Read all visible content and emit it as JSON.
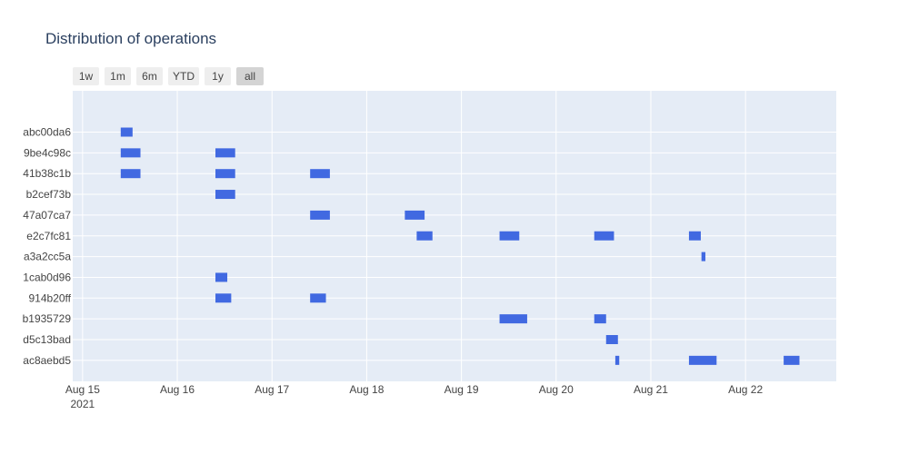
{
  "header": {
    "title": "Distribution of operations"
  },
  "range_selector": {
    "buttons": [
      {
        "label": "1w"
      },
      {
        "label": "1m"
      },
      {
        "label": "6m"
      },
      {
        "label": "YTD"
      },
      {
        "label": "1y"
      },
      {
        "label": "all",
        "active": true
      }
    ]
  },
  "colors": {
    "plot_bg": "#e5ecf6",
    "bar": "#4169e1",
    "grid": "#ffffff"
  },
  "chart_data": {
    "type": "timeline",
    "title": "Distribution of operations",
    "xlabel": "",
    "ylabel": "",
    "x_range": [
      "2021-08-14T21:30",
      "2021-08-22T23:00"
    ],
    "x_ticks": [
      {
        "value": "2021-08-15",
        "label": "Aug 15",
        "sublabel": "2021"
      },
      {
        "value": "2021-08-16",
        "label": "Aug 16"
      },
      {
        "value": "2021-08-17",
        "label": "Aug 17"
      },
      {
        "value": "2021-08-18",
        "label": "Aug 18"
      },
      {
        "value": "2021-08-19",
        "label": "Aug 19"
      },
      {
        "value": "2021-08-20",
        "label": "Aug 20"
      },
      {
        "value": "2021-08-21",
        "label": "Aug 21"
      },
      {
        "value": "2021-08-22",
        "label": "Aug 22"
      }
    ],
    "categories": [
      "abc00da6",
      "9be4c98c",
      "41b38c1b",
      "b2cef73b",
      "47a07ca7",
      "e2c7fc81",
      "a3a2cc5a",
      "1cab0d96",
      "914b20ff",
      "b1935729",
      "d5c13bad",
      "ac8aebd5"
    ],
    "series": [
      {
        "color": "#4169e1",
        "tasks": [
          {
            "row": "abc00da6",
            "start": "2021-08-15T09:40",
            "end": "2021-08-15T12:40"
          },
          {
            "row": "9be4c98c",
            "start": "2021-08-15T09:40",
            "end": "2021-08-15T14:40"
          },
          {
            "row": "9be4c98c",
            "start": "2021-08-16T09:40",
            "end": "2021-08-16T14:40"
          },
          {
            "row": "41b38c1b",
            "start": "2021-08-15T09:40",
            "end": "2021-08-15T14:40"
          },
          {
            "row": "41b38c1b",
            "start": "2021-08-16T09:40",
            "end": "2021-08-16T14:40"
          },
          {
            "row": "41b38c1b",
            "start": "2021-08-17T09:40",
            "end": "2021-08-17T14:40"
          },
          {
            "row": "b2cef73b",
            "start": "2021-08-16T09:40",
            "end": "2021-08-16T14:40"
          },
          {
            "row": "47a07ca7",
            "start": "2021-08-17T09:40",
            "end": "2021-08-17T14:40"
          },
          {
            "row": "47a07ca7",
            "start": "2021-08-18T09:40",
            "end": "2021-08-18T14:40"
          },
          {
            "row": "e2c7fc81",
            "start": "2021-08-18T12:40",
            "end": "2021-08-18T16:40"
          },
          {
            "row": "e2c7fc81",
            "start": "2021-08-19T09:40",
            "end": "2021-08-19T14:40"
          },
          {
            "row": "e2c7fc81",
            "start": "2021-08-20T09:40",
            "end": "2021-08-20T14:40"
          },
          {
            "row": "e2c7fc81",
            "start": "2021-08-21T09:40",
            "end": "2021-08-21T12:40"
          },
          {
            "row": "a3a2cc5a",
            "start": "2021-08-21T12:50",
            "end": "2021-08-21T13:50"
          },
          {
            "row": "1cab0d96",
            "start": "2021-08-16T09:40",
            "end": "2021-08-16T12:40"
          },
          {
            "row": "914b20ff",
            "start": "2021-08-16T09:40",
            "end": "2021-08-16T13:40"
          },
          {
            "row": "914b20ff",
            "start": "2021-08-17T09:40",
            "end": "2021-08-17T13:40"
          },
          {
            "row": "b1935729",
            "start": "2021-08-19T09:40",
            "end": "2021-08-19T16:40"
          },
          {
            "row": "b1935729",
            "start": "2021-08-20T09:40",
            "end": "2021-08-20T12:40"
          },
          {
            "row": "d5c13bad",
            "start": "2021-08-20T12:40",
            "end": "2021-08-20T15:40"
          },
          {
            "row": "ac8aebd5",
            "start": "2021-08-20T15:00",
            "end": "2021-08-20T16:00"
          },
          {
            "row": "ac8aebd5",
            "start": "2021-08-21T09:40",
            "end": "2021-08-21T16:40"
          },
          {
            "row": "ac8aebd5",
            "start": "2021-08-22T09:40",
            "end": "2021-08-22T13:40"
          }
        ]
      }
    ],
    "grid": true,
    "legend": false
  }
}
